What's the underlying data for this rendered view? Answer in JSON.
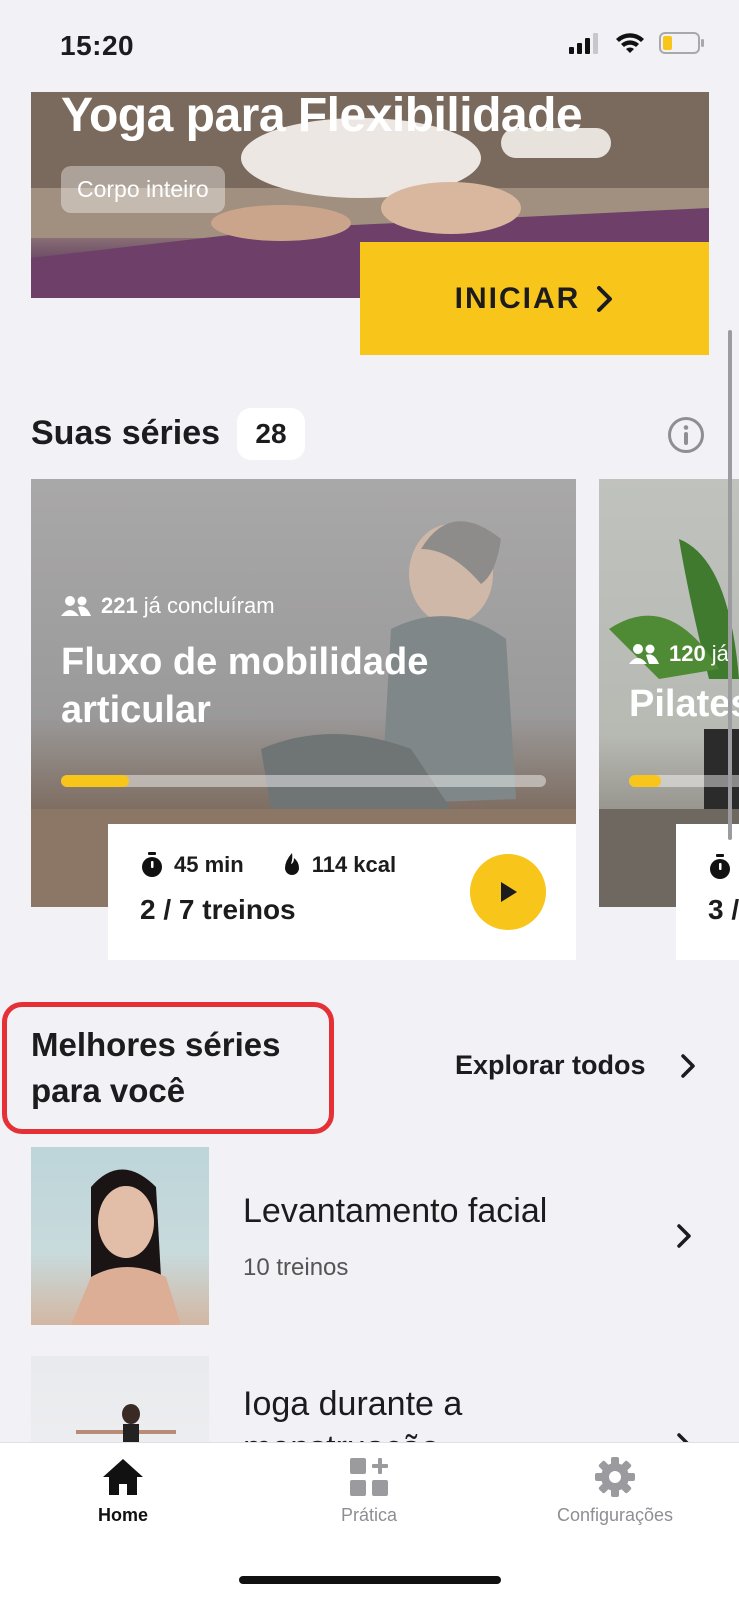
{
  "status_bar": {
    "time": "15:20"
  },
  "hero": {
    "title": "Yoga para Flexibilidade",
    "tag": "Corpo inteiro",
    "start_label": "INICIAR"
  },
  "series": {
    "title": "Suas séries",
    "count": "28",
    "cards": [
      {
        "completed_count": "221",
        "completed_text": "já concluíram",
        "title": "Fluxo de mobilidade articular",
        "progress": 0.14,
        "duration": "45 min",
        "calories": "114 kcal",
        "workouts": "2 / 7 treinos"
      },
      {
        "completed_count": "120",
        "completed_text": "já",
        "title": "Pilates",
        "progress": 0.2,
        "workouts": "3 /"
      }
    ]
  },
  "best": {
    "title": "Melhores séries para você",
    "explore_label": "Explorar todos",
    "items": [
      {
        "title": "Levantamento facial",
        "subtitle": "10 treinos"
      },
      {
        "title": "Ioga durante a menstruação"
      }
    ]
  },
  "nav": {
    "items": [
      {
        "label": "Home",
        "icon": "house-icon",
        "active": true
      },
      {
        "label": "Prática",
        "icon": "grid-plus-icon",
        "active": false
      },
      {
        "label": "Configurações",
        "icon": "gear-icon",
        "active": false
      }
    ]
  },
  "colors": {
    "accent": "#f8c51b",
    "highlight": "#e53135",
    "background": "#f1f1f6"
  }
}
